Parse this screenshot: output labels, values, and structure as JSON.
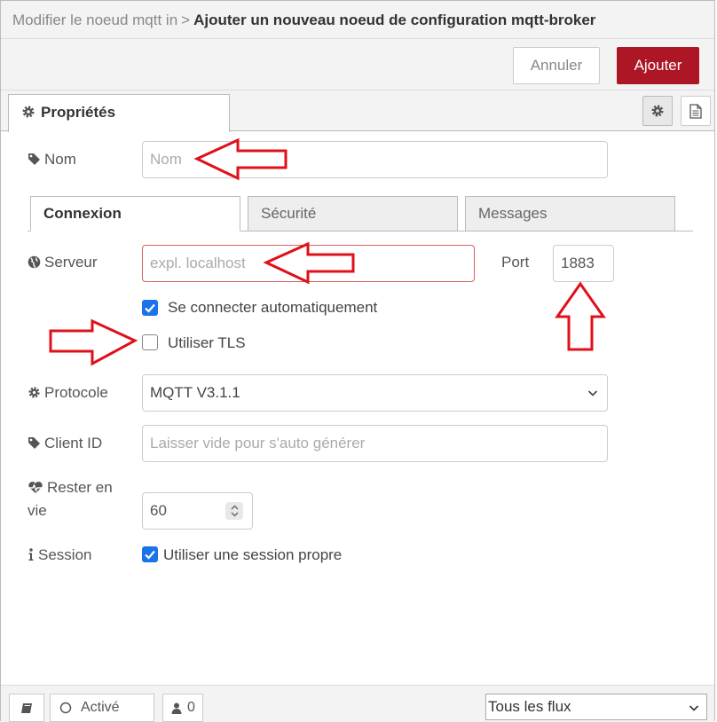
{
  "header": {
    "breadcrumb_prev": "Modifier le noeud mqtt in",
    "breadcrumb_sep": ">",
    "title": "Ajouter un nouveau noeud de configuration mqtt-broker"
  },
  "toolbar": {
    "cancel_label": "Annuler",
    "add_label": "Ajouter"
  },
  "tabs": {
    "properties_label": "Propriétés"
  },
  "form": {
    "name": {
      "label": "Nom",
      "placeholder": "Nom",
      "value": ""
    },
    "subtabs": [
      "Connexion",
      "Sécurité",
      "Messages"
    ],
    "server": {
      "label": "Serveur",
      "placeholder": "expl. localhost",
      "value": ""
    },
    "port": {
      "label": "Port",
      "value": "1883"
    },
    "auto_connect": {
      "label": "Se connecter automatiquement",
      "checked": true
    },
    "use_tls": {
      "label": "Utiliser TLS",
      "checked": false
    },
    "protocol": {
      "label": "Protocole",
      "value": "MQTT V3.1.1"
    },
    "client_id": {
      "label": "Client ID",
      "placeholder": "Laisser vide pour s'auto générer"
    },
    "keepalive": {
      "label_line1": "Rester en",
      "label_line2": "vie",
      "value": "60"
    },
    "session": {
      "label": "Session",
      "checkbox_label": "Utiliser une session propre",
      "checked": true
    }
  },
  "footer": {
    "enabled_label": "Activé",
    "users_count": "0",
    "scope": "Tous les flux"
  },
  "colors": {
    "primary_button": "#ad1625",
    "checkbox": "#1a73e8",
    "annotation_arrow": "#e0101a"
  }
}
